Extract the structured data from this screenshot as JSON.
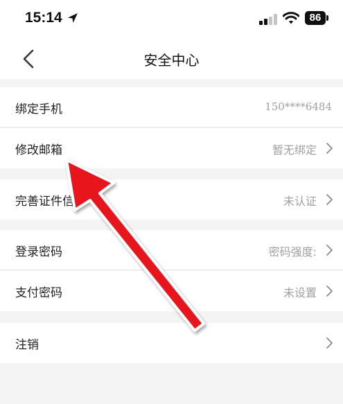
{
  "status_bar": {
    "time": "15:14",
    "battery_level": "86",
    "icons": [
      "location-arrow-icon",
      "signal-icon",
      "wifi-icon",
      "battery-icon"
    ]
  },
  "nav": {
    "title": "安全中心",
    "back_icon": "chevron-left-icon"
  },
  "sections": {
    "bind_phone": {
      "label": "绑定手机",
      "value": "150****6484"
    },
    "modify_email": {
      "label": "修改邮箱",
      "value": "暂无绑定"
    },
    "id_info": {
      "label": "完善证件信息",
      "value": "未认证"
    },
    "login_password": {
      "label": "登录密码",
      "value": "密码强度:"
    },
    "pay_password": {
      "label": "支付密码",
      "value": "未设置"
    },
    "deregister": {
      "label": "注销",
      "value": ""
    }
  },
  "colors": {
    "background": "#f4f4f4",
    "row": "#ffffff",
    "secondary_text": "#a0a0a0",
    "annotation_arrow": "#e8141a"
  },
  "annotation": {
    "type": "red-arrow-icon"
  }
}
